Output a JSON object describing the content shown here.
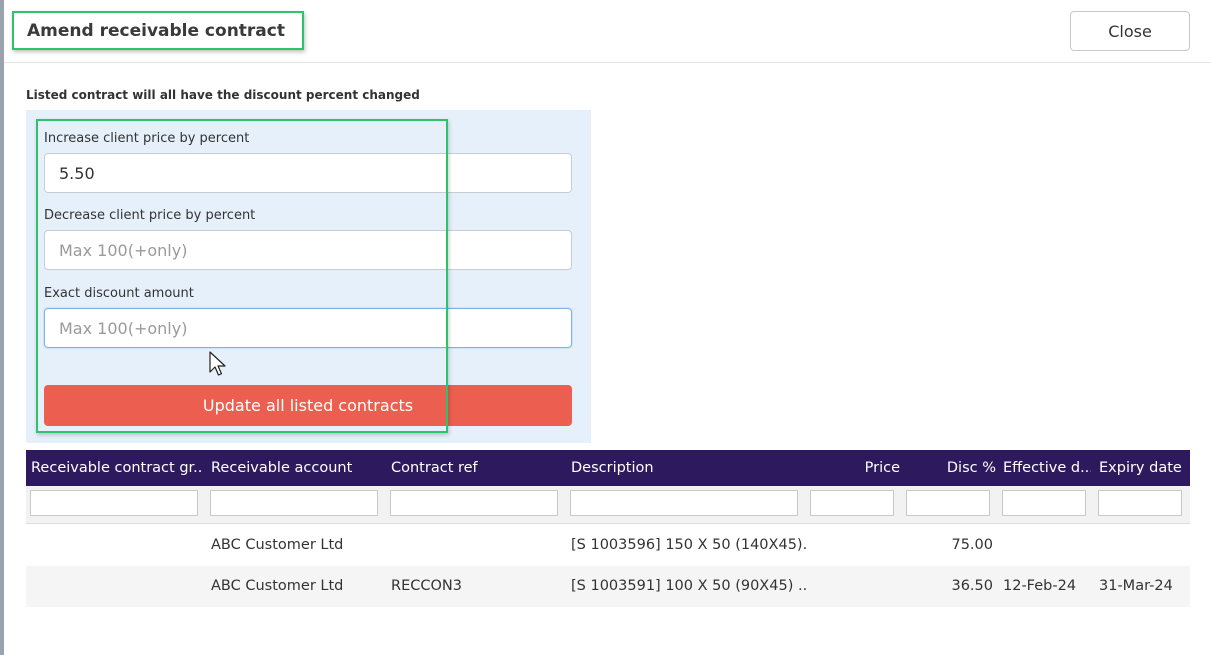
{
  "dialog": {
    "title": "Amend receivable contract",
    "close_label": "Close"
  },
  "form": {
    "instruction": "Listed contract will all have the discount percent changed",
    "increase": {
      "label": "Increase client price by percent",
      "value": "5.50",
      "placeholder": "Max 100(+only)"
    },
    "decrease": {
      "label": "Decrease client price by percent",
      "value": "",
      "placeholder": "Max 100(+only)"
    },
    "exact": {
      "label": "Exact discount amount",
      "value": "",
      "placeholder": "Max 100(+only)"
    },
    "update_label": "Update all listed contracts"
  },
  "grid": {
    "columns": [
      "Receivable contract gr...",
      "Receivable account",
      "Contract ref",
      "Description",
      "Price",
      "Disc %",
      "Effective d...",
      "Expiry date"
    ],
    "rows": [
      {
        "group": "",
        "account": "ABC Customer Ltd",
        "ref": "",
        "description": "[S 1003596] 150 X 50 (140X45)...",
        "price": "",
        "disc": "75.00",
        "effective": "",
        "expiry": ""
      },
      {
        "group": "",
        "account": "ABC Customer Ltd",
        "ref": "RECCON3",
        "description": "[S 1003591] 100 X 50 (90X45) ...",
        "price": "",
        "disc": "36.50",
        "effective": "12-Feb-24",
        "expiry": "31-Mar-24"
      }
    ]
  },
  "colors": {
    "header_bg": "#2d1a5e",
    "update_button": "#ec5e50",
    "highlight": "#2ec26a",
    "panel_bg": "#e6f0fb"
  }
}
